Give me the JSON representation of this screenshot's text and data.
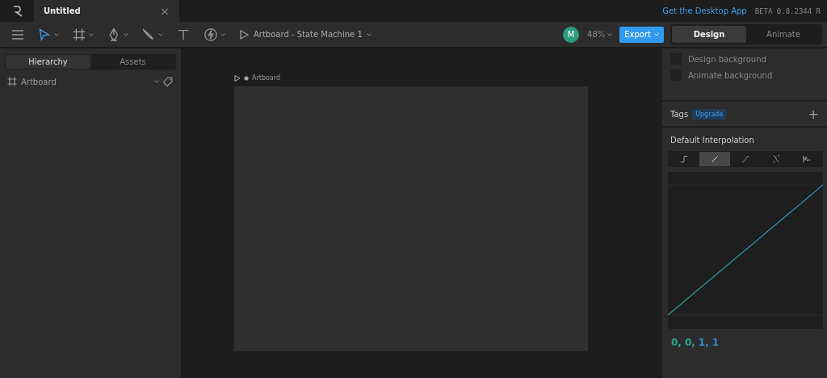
{
  "tab": {
    "title": "Untitled",
    "close": "×"
  },
  "header": {
    "link": "Get the Desktop App",
    "version": "BETA 0.8.2344 R"
  },
  "toolbar": {
    "tools": [
      {
        "kind": "select",
        "selected": true
      },
      {
        "kind": "frame",
        "selected": false
      },
      {
        "kind": "pen",
        "selected": false
      },
      {
        "kind": "brush",
        "selected": false
      },
      {
        "kind": "text",
        "selected": false
      },
      {
        "kind": "bolt",
        "selected": false
      }
    ],
    "artboard_menu": "Artboard - State Machine 1",
    "avatar": "M",
    "zoom": "48%",
    "export": "Export"
  },
  "mode_tabs": [
    {
      "label": "Design",
      "selected": true
    },
    {
      "label": "Animate",
      "selected": false
    }
  ],
  "left_tabs": [
    {
      "label": "Hierarchy",
      "selected": true
    },
    {
      "label": "Assets",
      "selected": false
    }
  ],
  "hierarchy": [
    {
      "label": "Artboard"
    }
  ],
  "canvas": {
    "artboard_label": "Artboard"
  },
  "backgrounds": [
    {
      "label": "Design background",
      "checked": false
    },
    {
      "label": "Animate background",
      "checked": false
    }
  ],
  "tags": {
    "label": "Tags",
    "badge": "Upgrade",
    "add": "+"
  },
  "interpolation": {
    "title": "Default Interpolation",
    "options": [
      {
        "kind": "hold",
        "selected": false
      },
      {
        "kind": "linear",
        "selected": true
      },
      {
        "kind": "cubic",
        "selected": false
      },
      {
        "kind": "custom",
        "selected": false
      },
      {
        "kind": "elastic",
        "selected": false
      }
    ],
    "values": [
      {
        "text": "0,",
        "color": "#2aa58c"
      },
      {
        "text": "0,",
        "color": "#2aa58c"
      },
      {
        "text": "1,",
        "color": "#2b8fd6"
      },
      {
        "text": "1",
        "color": "#2b8fd6"
      }
    ]
  }
}
